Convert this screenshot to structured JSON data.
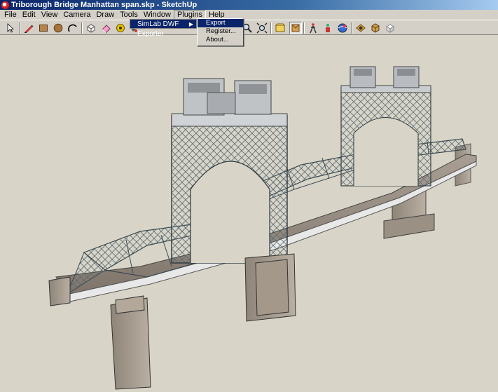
{
  "window": {
    "title": "Triborough Bridge Manhattan span.skp - SketchUp"
  },
  "menubar": {
    "items": [
      "File",
      "Edit",
      "View",
      "Camera",
      "Draw",
      "Tools",
      "Window",
      "Plugins",
      "Help"
    ],
    "active": "Plugins"
  },
  "plugins_menu": {
    "item": "SimLab DWF Exporter",
    "submenu": [
      "Export",
      "Register...",
      "About..."
    ],
    "highlighted": "Export"
  },
  "toolbar": {
    "icons": [
      "select-icon",
      "pencil-icon",
      "rectangle-icon",
      "circle-icon",
      "arc-icon",
      "make-component-icon",
      "eraser-icon",
      "tape-measure-icon",
      "paint-bucket-icon",
      "zoom-icon",
      "zoom-extents-icon",
      "previous-view-icon",
      "position-camera-icon",
      "walk-icon",
      "look-around-icon",
      "get-models-icon",
      "share-model-icon",
      "component-icon",
      "materials-icon",
      "styles-icon"
    ],
    "pressed": "position-camera-icon"
  },
  "colors": {
    "titlebar": "#0a246a",
    "menu_highlight": "#0a246a",
    "viewport_bg": "#d8d5c8"
  }
}
